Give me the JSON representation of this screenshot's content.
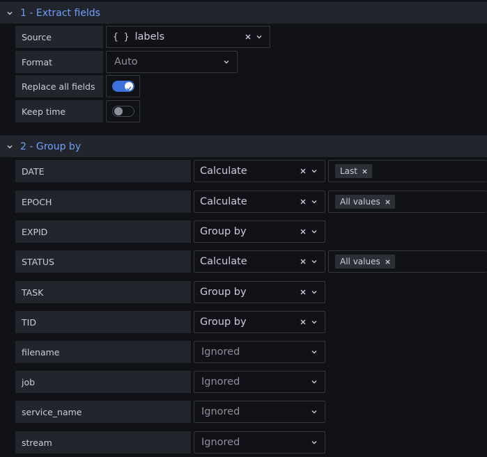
{
  "sections": [
    {
      "title": "1 - Extract fields"
    },
    {
      "title": "2 - Group by"
    }
  ],
  "extract": {
    "source_label": "Source",
    "source_value": "labels",
    "source_prefix": "{ }",
    "format_label": "Format",
    "format_value": "Auto",
    "replace_label": "Replace all fields",
    "replace_on": true,
    "keep_label": "Keep time",
    "keep_on": false
  },
  "group_rows": [
    {
      "name": "DATE",
      "value": "Calculate",
      "clearable": true,
      "tag": "Last"
    },
    {
      "name": "EPOCH",
      "value": "Calculate",
      "clearable": true,
      "tag": "All values"
    },
    {
      "name": "EXPID",
      "value": "Group by",
      "clearable": true,
      "tag": null
    },
    {
      "name": "STATUS",
      "value": "Calculate",
      "clearable": true,
      "tag": "All values"
    },
    {
      "name": "TASK",
      "value": "Group by",
      "clearable": true,
      "tag": null
    },
    {
      "name": "TID",
      "value": "Group by",
      "clearable": true,
      "tag": null
    },
    {
      "name": "filename",
      "value": "Ignored",
      "clearable": false,
      "tag": null
    },
    {
      "name": "job",
      "value": "Ignored",
      "clearable": false,
      "tag": null
    },
    {
      "name": "service_name",
      "value": "Ignored",
      "clearable": false,
      "tag": null
    },
    {
      "name": "stream",
      "value": "Ignored",
      "clearable": false,
      "tag": null
    }
  ],
  "colors": {
    "accent": "#6e9fff",
    "toggle_on": "#3d71d9",
    "panel": "#22252b",
    "bg": "#111217"
  },
  "icons": {
    "collapse": "chevron-down-icon",
    "clear": "close-icon",
    "dropdown": "chevron-down-icon",
    "check": "check-icon"
  }
}
